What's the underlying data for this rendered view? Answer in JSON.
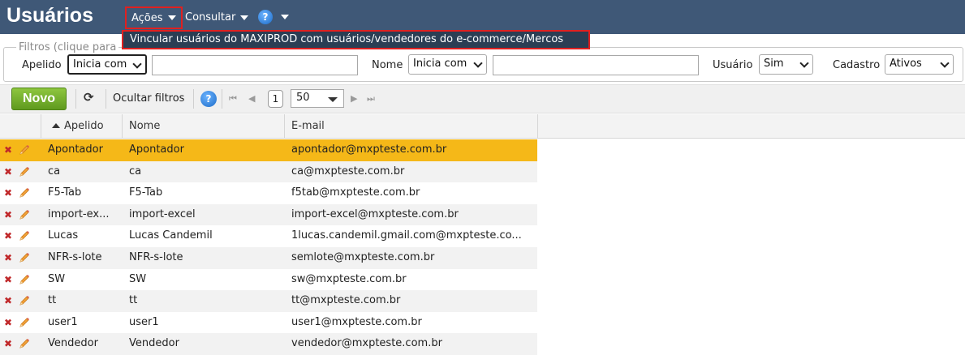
{
  "header": {
    "title": "Usuários",
    "menus": {
      "acoes": "Ações",
      "consultar": "Consultar"
    },
    "help_glyph": "?"
  },
  "dropdown": {
    "item": "Vincular usuários do MAXIPROD com usuários/vendedores do e-commerce/Mercos"
  },
  "filters": {
    "legend": "Filtros (clique para ",
    "apelido_label": "Apelido",
    "apelido_mode": "Inicia com",
    "apelido_value": "",
    "nome_label": "Nome",
    "nome_mode": "Inicia com",
    "nome_value": "",
    "usuario_label": "Usuário",
    "usuario_value": "Sim",
    "cadastro_label": "Cadastro",
    "cadastro_value": "Ativos"
  },
  "toolbar": {
    "novo": "Novo",
    "refresh_glyph": "⟳",
    "ocultar": "Ocultar filtros",
    "help_glyph": "?",
    "first_glyph": "⏮",
    "prev_glyph": "◀",
    "page": "1",
    "page_size": "50",
    "next_glyph": "▶",
    "last_glyph": "⏭"
  },
  "table": {
    "columns": [
      "Apelido",
      "Nome",
      "E-mail"
    ],
    "rows": [
      {
        "apelido": "Apontador",
        "nome": "Apontador",
        "email": "apontador@mxpteste.com.br"
      },
      {
        "apelido": "ca",
        "nome": "ca",
        "email": "ca@mxpteste.com.br"
      },
      {
        "apelido": "F5-Tab",
        "nome": "F5-Tab",
        "email": "f5tab@mxpteste.com.br"
      },
      {
        "apelido": "import-ex...",
        "nome": "import-excel",
        "email": "import-excel@mxpteste.com.br"
      },
      {
        "apelido": "Lucas",
        "nome": "Lucas Candemil",
        "email": "1lucas.candemil.gmail.com@mxpteste.co..."
      },
      {
        "apelido": "NFR-s-lote",
        "nome": "NFR-s-lote",
        "email": "semlote@mxpteste.com.br"
      },
      {
        "apelido": "SW",
        "nome": "SW",
        "email": "sw@mxpteste.com.br"
      },
      {
        "apelido": "tt",
        "nome": "tt",
        "email": "tt@mxpteste.com.br"
      },
      {
        "apelido": "user1",
        "nome": "user1",
        "email": "user1@mxpteste.com.br"
      },
      {
        "apelido": "Vendedor",
        "nome": "Vendedor",
        "email": "vendedor@mxpteste.com.br"
      }
    ],
    "delete_glyph": "✖"
  },
  "colors": {
    "header_bg": "#3f5877",
    "selected_row": "#f5b818",
    "novo_green": "#6fad2a",
    "highlight_border": "#e02020"
  },
  "icons": [
    "caret-down-icon",
    "help-icon",
    "refresh-icon",
    "delete-icon",
    "edit-pencil-icon",
    "sort-asc-icon"
  ]
}
